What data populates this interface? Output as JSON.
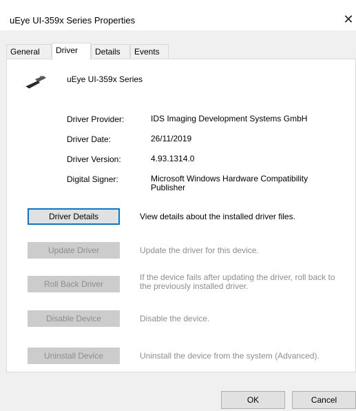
{
  "window": {
    "title": "uEye UI-359x Series Properties",
    "close_glyph": "✕"
  },
  "tabs": [
    {
      "label": "General"
    },
    {
      "label": "Driver"
    },
    {
      "label": "Details"
    },
    {
      "label": "Events"
    }
  ],
  "active_tab": "Driver",
  "device": {
    "name": "uEye UI-359x Series",
    "icon": "usb-plug-icon"
  },
  "properties": {
    "provider_label": "Driver Provider:",
    "provider_value": "IDS Imaging Development Systems GmbH",
    "date_label": "Driver Date:",
    "date_value": "26/11/2019",
    "version_label": "Driver Version:",
    "version_value": "4.93.1314.0",
    "signer_label": "Digital Signer:",
    "signer_value": "Microsoft Windows Hardware Compatibility Publisher"
  },
  "actions": [
    {
      "label": "Driver Details",
      "description": "View details about the installed driver files.",
      "enabled": true
    },
    {
      "label": "Update Driver",
      "description": "Update the driver for this device.",
      "enabled": false
    },
    {
      "label": "Roll Back Driver",
      "description": "If the device fails after updating the driver, roll back to the previously installed driver.",
      "enabled": false
    },
    {
      "label": "Disable Device",
      "description": "Disable the device.",
      "enabled": false
    },
    {
      "label": "Uninstall Device",
      "description": "Uninstall the device from the system (Advanced).",
      "enabled": false
    }
  ],
  "footer": {
    "ok_label": "OK",
    "cancel_label": "Cancel"
  }
}
